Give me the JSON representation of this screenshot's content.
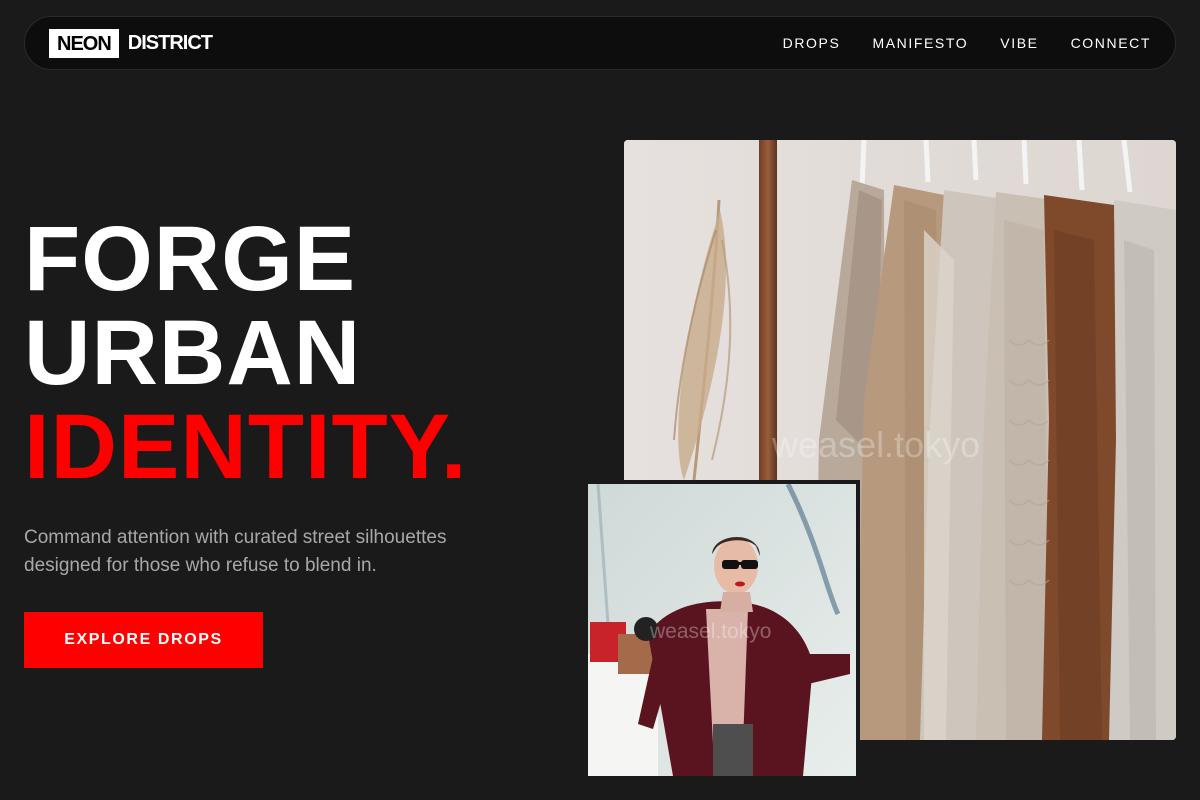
{
  "brand": {
    "logo_box": "NEON",
    "logo_text": "DISTRICT"
  },
  "nav": {
    "items": [
      {
        "label": "DROPS"
      },
      {
        "label": "MANIFESTO"
      },
      {
        "label": "VIBE"
      },
      {
        "label": "CONNECT"
      }
    ]
  },
  "hero": {
    "title_line1": "FORGE",
    "title_line2": "URBAN",
    "title_line3": "IDENTITY.",
    "subtitle": "Command attention with curated street silhouettes designed for those who refuse to blend in.",
    "cta_label": "EXPLORE DROPS"
  },
  "images": {
    "main_watermark": "weasel.tokyo",
    "inset_watermark": "weasel.tokyo"
  },
  "colors": {
    "accent": "#ff0000",
    "background": "#1a1a1a",
    "nav_background": "#0d0d0d",
    "subtitle": "#a8a8a8"
  }
}
